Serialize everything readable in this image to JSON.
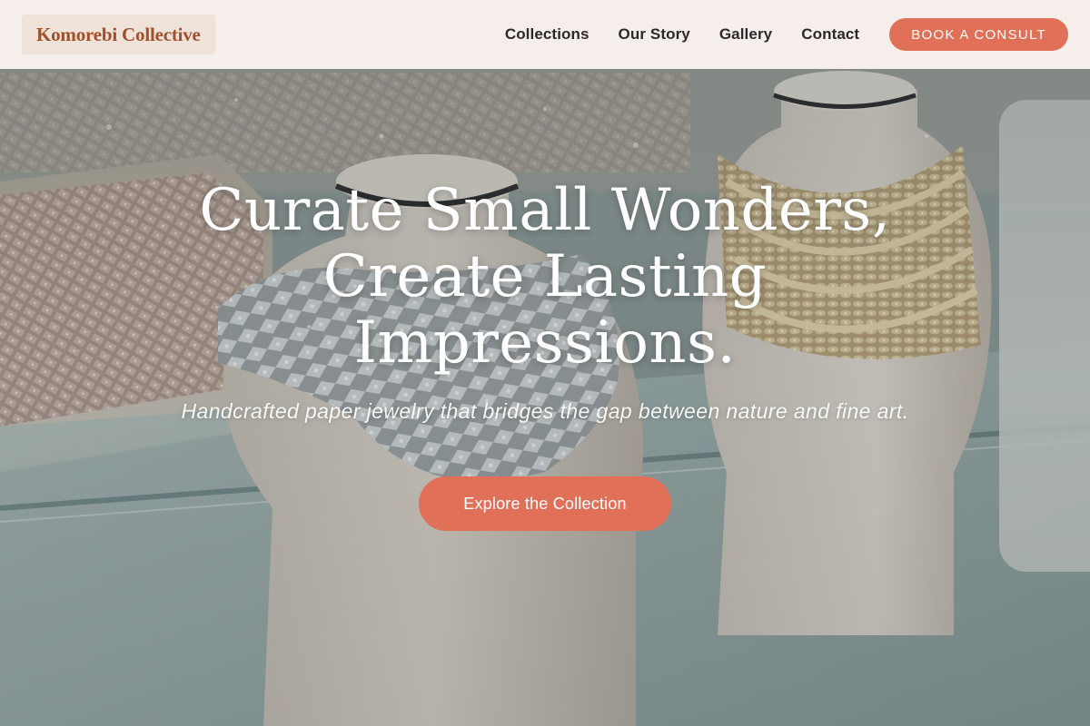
{
  "brand": {
    "name": "Komorebi Collective"
  },
  "nav": {
    "links": [
      {
        "label": "Collections"
      },
      {
        "label": "Our Story"
      },
      {
        "label": "Gallery"
      },
      {
        "label": "Contact"
      }
    ],
    "cta_label": "BOOK A CONSULT"
  },
  "hero": {
    "title_lines": [
      "Curate Small Wonders,",
      "Create Lasting",
      "Impressions."
    ],
    "subtitle": "Handcrafted paper jewelry that bridges the gap between nature and fine art.",
    "button_label": "Explore the Collection",
    "background_image": "jewelry-display-photo"
  },
  "colors": {
    "accent": "#e07158",
    "brand_text": "#a24f2c",
    "nav_bg": "#fbf3ee"
  }
}
